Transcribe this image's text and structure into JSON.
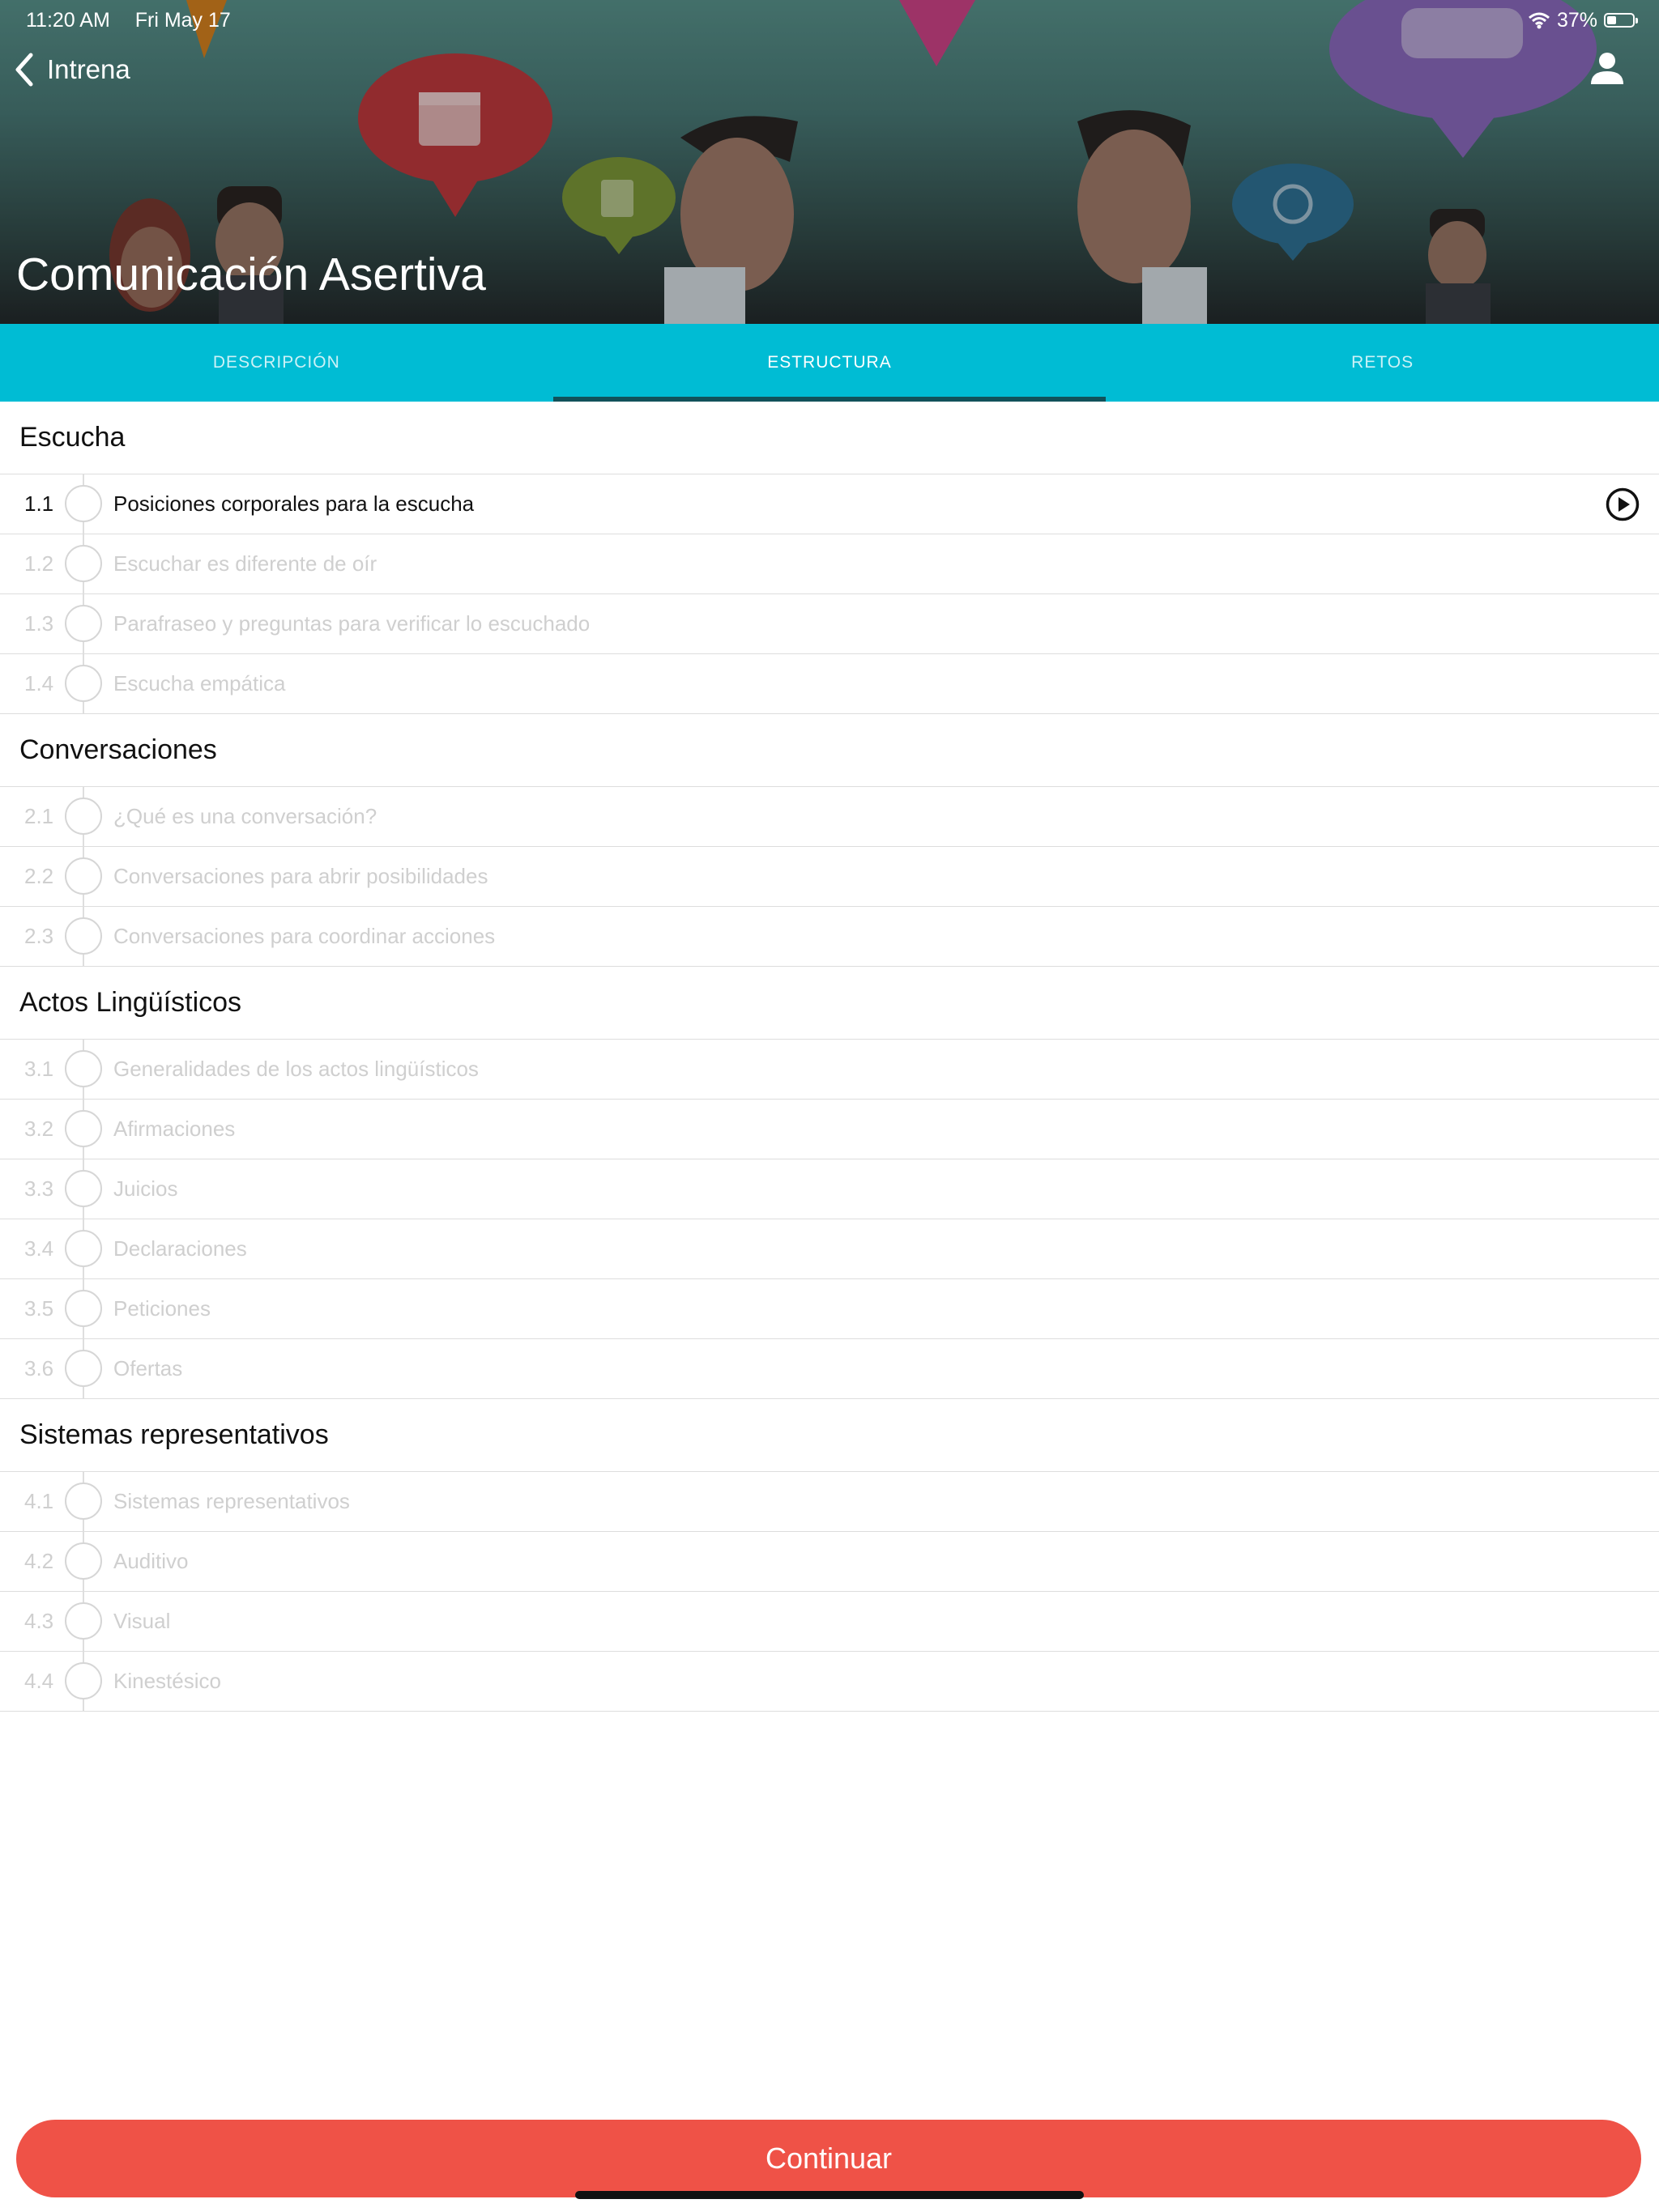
{
  "status_bar": {
    "time": "11:20 AM",
    "date": "Fri May 17",
    "battery": "37%",
    "battery_level": 0.37
  },
  "nav": {
    "back_label": "Intrena"
  },
  "course": {
    "title": "Comunicación Asertiva"
  },
  "tabs": [
    {
      "label": "DESCRIPCIÓN",
      "active": false
    },
    {
      "label": "ESTRUCTURA",
      "active": true
    },
    {
      "label": "RETOS",
      "active": false
    }
  ],
  "sections": [
    {
      "title": "Escucha",
      "lessons": [
        {
          "num": "1.1",
          "title": "Posiciones corporales para la escucha",
          "active": true
        },
        {
          "num": "1.2",
          "title": "Escuchar es diferente de oír"
        },
        {
          "num": "1.3",
          "title": "Parafraseo y preguntas para verificar lo escuchado"
        },
        {
          "num": "1.4",
          "title": "Escucha empática"
        }
      ]
    },
    {
      "title": "Conversaciones",
      "lessons": [
        {
          "num": "2.1",
          "title": "¿Qué es una conversación?"
        },
        {
          "num": "2.2",
          "title": "Conversaciones para abrir posibilidades"
        },
        {
          "num": "2.3",
          "title": "Conversaciones para coordinar acciones"
        }
      ]
    },
    {
      "title": "Actos Lingüísticos",
      "lessons": [
        {
          "num": "3.1",
          "title": "Generalidades de los actos lingüísticos"
        },
        {
          "num": "3.2",
          "title": "Afirmaciones"
        },
        {
          "num": "3.3",
          "title": "Juicios"
        },
        {
          "num": "3.4",
          "title": "Declaraciones"
        },
        {
          "num": "3.5",
          "title": "Peticiones"
        },
        {
          "num": "3.6",
          "title": "Ofertas"
        }
      ]
    },
    {
      "title": "Sistemas representativos",
      "lessons": [
        {
          "num": "4.1",
          "title": "Sistemas representativos"
        },
        {
          "num": "4.2",
          "title": "Auditivo"
        },
        {
          "num": "4.3",
          "title": "Visual"
        },
        {
          "num": "4.4",
          "title": "Kinestésico"
        }
      ]
    }
  ],
  "continue_button": {
    "label": "Continuar"
  },
  "colors": {
    "tab_bar": "#00bcd4",
    "tab_indicator": "#11525a",
    "continue": "#ef5247"
  },
  "icons": [
    "back-chevron-icon",
    "profile-icon",
    "wifi-icon",
    "battery-icon",
    "play-circle-icon"
  ]
}
